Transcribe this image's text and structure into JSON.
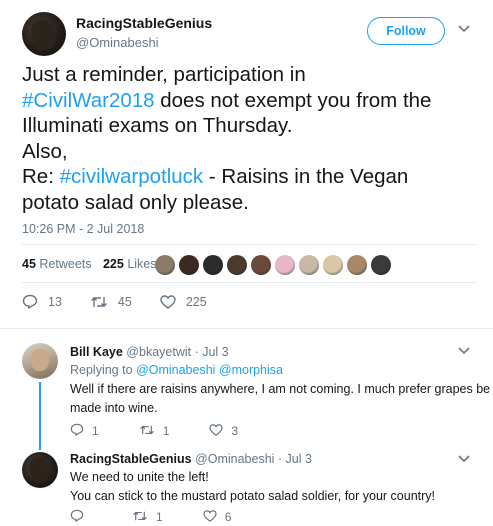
{
  "tweet": {
    "author_name": "RacingStableGenius",
    "author_handle": "@Ominabeshi",
    "follow_label": "Follow",
    "text_lines": [
      [
        {
          "t": "Just a reminder, participation in"
        }
      ],
      [
        {
          "t": "#CivilWar2018",
          "tag": true
        },
        {
          "t": " does not exempt you from the"
        }
      ],
      [
        {
          "t": "Illuminati exams on Thursday."
        }
      ],
      [
        {
          "t": "Also,"
        }
      ],
      [
        {
          "t": "Re: "
        },
        {
          "t": "#civilwarpotluck",
          "tag": true
        },
        {
          "t": " - Raisins in the Vegan"
        }
      ],
      [
        {
          "t": "potato salad only please."
        }
      ]
    ],
    "timestamp": "10:26 PM - 2 Jul 2018",
    "retweets_count": "45",
    "retweets_label": "Retweets",
    "likes_count": "225",
    "likes_label": "Likes",
    "liker_colors": [
      "#8b7b6b",
      "#3a2a20",
      "#2b2b2b",
      "#4a3b2b",
      "#6b4a3a",
      "#e8b8c8",
      "#c8b8a8",
      "#d8c8a8",
      "#a88868",
      "#3a3a3a"
    ],
    "actions": {
      "replies": "13",
      "retweets": "45",
      "likes": "225"
    }
  },
  "replies": [
    {
      "name": "Bill Kaye",
      "handle": "@bkayetwit",
      "time": "· Jul 3",
      "replying_prefix": "Replying to",
      "replying_to": "@Ominabeshi @morphisa",
      "body_lines": [
        "Well if there are raisins anywhere, I am not coming. I much prefer grapes be",
        "made into wine."
      ],
      "replies": "1",
      "retweets": "1",
      "likes": "3"
    },
    {
      "name": "RacingStableGenius",
      "handle": "@Ominabeshi",
      "time": "· Jul 3",
      "body_lines": [
        "We need to unite the left!",
        "You can stick to the mustard potato salad soldier, for your country!"
      ],
      "replies": "",
      "retweets": "1",
      "likes": "6"
    }
  ],
  "colors": {
    "accent": "#1da1f2",
    "muted": "#657786",
    "text": "#14171a",
    "divider": "#e6ecf0"
  }
}
